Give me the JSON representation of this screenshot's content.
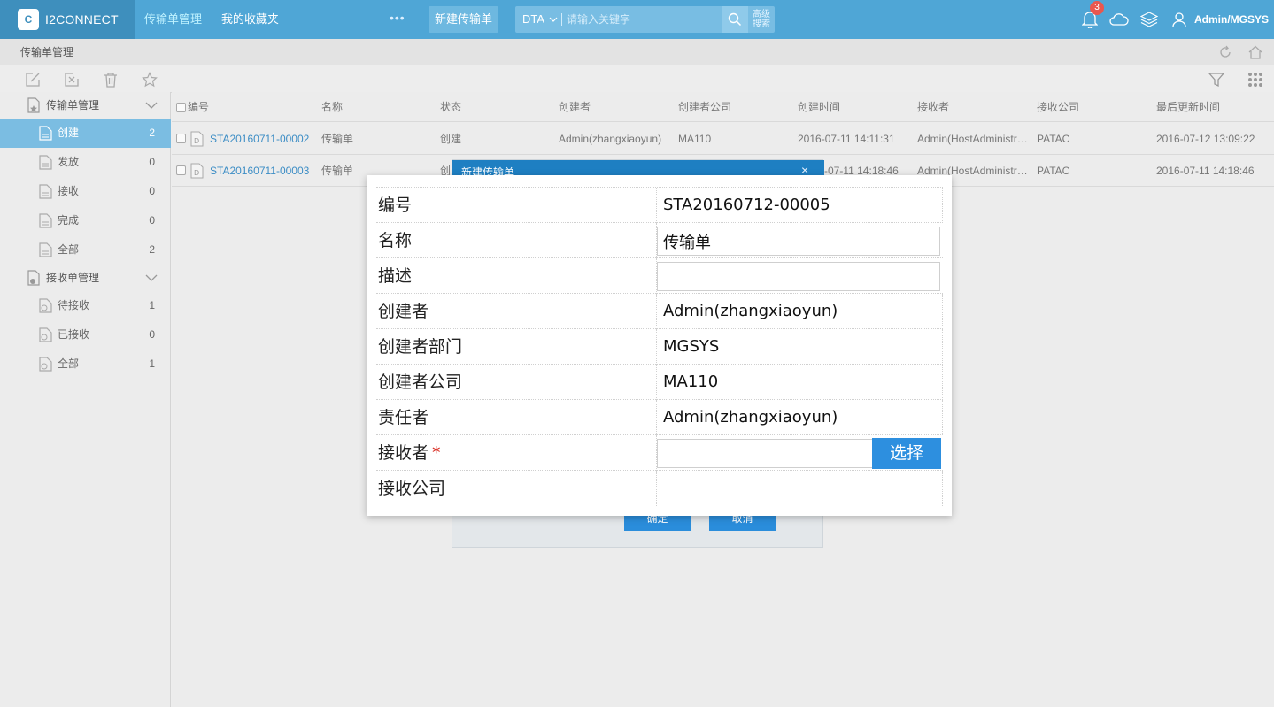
{
  "app": {
    "logo_text": "I2CONNECT",
    "logo_mark": "C"
  },
  "nav": {
    "tab_transfer": "传输单管理",
    "tab_favorites": "我的收藏夹",
    "more": "•••",
    "new_button": "新建传输单"
  },
  "search": {
    "type": "DTA",
    "placeholder": "请输入关键字",
    "advanced": "高级搜索"
  },
  "notifications": {
    "count": "3"
  },
  "user": {
    "label": "Admin/MGSYS"
  },
  "breadcrumb": "传输单管理",
  "sidebar": {
    "group1": "传输单管理",
    "group1_items": [
      {
        "label": "创建",
        "count": "2"
      },
      {
        "label": "发放",
        "count": "0"
      },
      {
        "label": "接收",
        "count": "0"
      },
      {
        "label": "完成",
        "count": "0"
      },
      {
        "label": "全部",
        "count": "2"
      }
    ],
    "group2": "接收单管理",
    "group2_items": [
      {
        "label": "待接收",
        "count": "1"
      },
      {
        "label": "已接收",
        "count": "0"
      },
      {
        "label": "全部",
        "count": "1"
      }
    ]
  },
  "table": {
    "headers": [
      "编号",
      "名称",
      "状态",
      "创建者",
      "创建者公司",
      "创建时间",
      "接收者",
      "接收公司",
      "最后更新时间"
    ],
    "rows": [
      [
        "STA20160711-00002",
        "传输单",
        "创建",
        "Admin(zhangxiaoyun)",
        "MA110",
        "2016-07-11 14:11:31",
        "Admin(HostAdministr…",
        "PATAC",
        "2016-07-12 13:09:22"
      ],
      [
        "STA20160711-00003",
        "传输单",
        "创",
        "",
        "",
        "-07-11 14:18:46",
        "Admin(HostAdministr…",
        "PATAC",
        "2016-07-11 14:18:46"
      ]
    ]
  },
  "bg_dialog": {
    "title": "新建传输单",
    "close": "×",
    "ok": "确定",
    "cancel": "取消"
  },
  "form": {
    "number_label": "编号",
    "number_value": "STA20160712-00005",
    "name_label": "名称",
    "name_value": "传输单",
    "desc_label": "描述",
    "desc_value": "",
    "creator_label": "创建者",
    "creator_value": "Admin(zhangxiaoyun)",
    "dept_label": "创建者部门",
    "dept_value": "MGSYS",
    "company_label": "创建者公司",
    "company_value": "MA110",
    "owner_label": "责任者",
    "owner_value": "Admin(zhangxiaoyun)",
    "receiver_label": "接收者",
    "required_mark": "*",
    "receiver_value": "",
    "select_button": "选择",
    "recv_company_label": "接收公司"
  },
  "colors": {
    "topbar": "#4fa6d6",
    "logo_bg": "#3e8fbd",
    "active_side": "#7bbde2",
    "link": "#3c8dc5",
    "primary_btn": "#2d8fdf",
    "required": "#d8281e"
  }
}
